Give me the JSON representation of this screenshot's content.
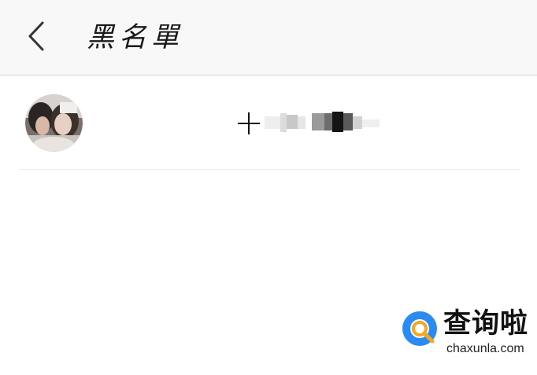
{
  "header": {
    "back_icon": "chevron-left-icon",
    "title": "黑名單"
  },
  "blacklist": {
    "items": [
      {
        "avatar": "user-avatar-photo",
        "prefix_icon": "plus-icon",
        "name": ""
      }
    ]
  },
  "watermark": {
    "brand": "查询啦",
    "url": "chaxunla.com",
    "colors": {
      "blue": "#2b8bf2",
      "orange": "#f5a623"
    }
  }
}
